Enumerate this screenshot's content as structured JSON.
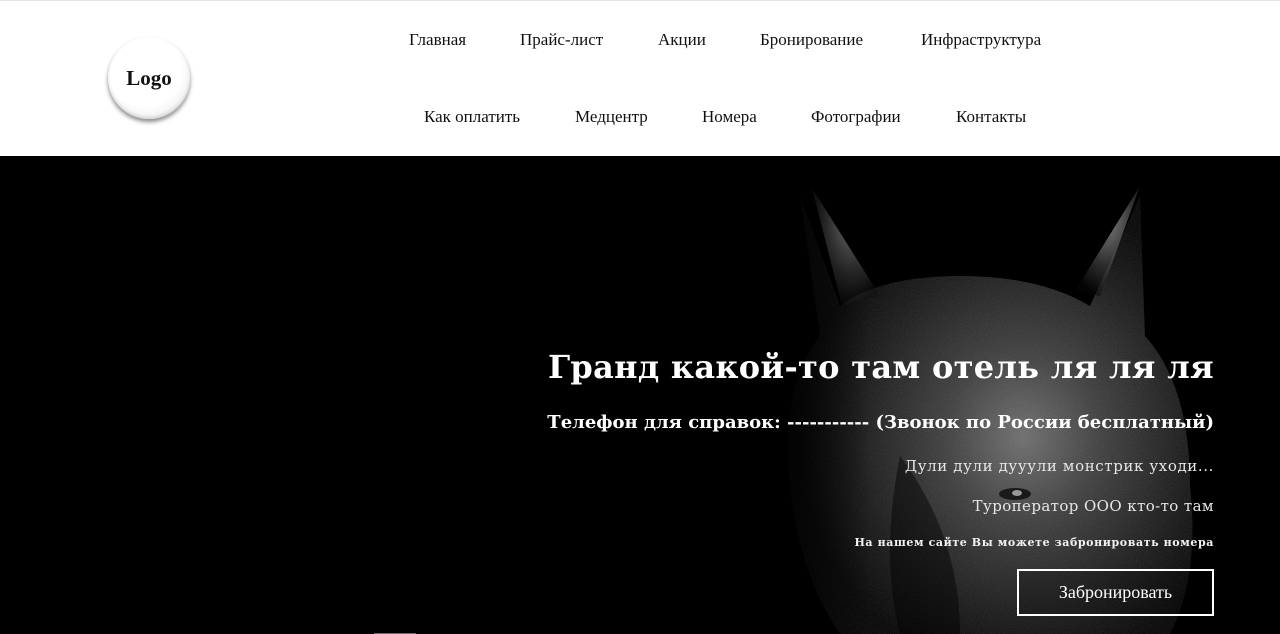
{
  "header": {
    "logo_text": "Logo",
    "nav_row1": [
      "Главная",
      "Прайс-лист",
      "Акции",
      "Бронирование",
      "Инфраструктура"
    ],
    "nav_row2": [
      "Как оплатить",
      "Медцентр",
      "Номера",
      "Фотографии",
      "Контакты"
    ]
  },
  "hero": {
    "title": "Гранд какой-то там отель ля ля ля",
    "phone": "Телефон для справок: ----------- (Звонок по России бесплатный)",
    "line1": "Дули дули дууули монстрик уходи...",
    "line2": "Туроператор ООО кто-то там",
    "note": "На нашем сайте Вы можете забронировать номера",
    "button_label": "Забронировать"
  }
}
